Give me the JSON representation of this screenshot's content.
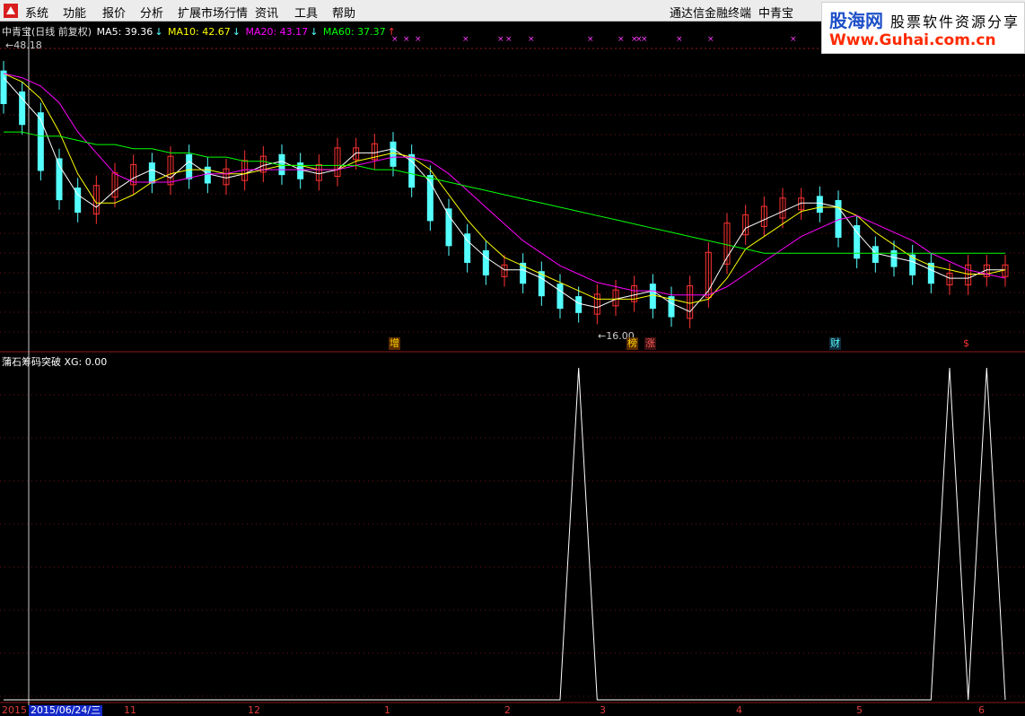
{
  "menu": {
    "items": [
      "系统",
      "功能",
      "报价",
      "分析",
      "扩展市场行情",
      "资讯",
      "工具",
      "帮助"
    ],
    "right_title": "通达信金融终端",
    "stock_name": "中青宝"
  },
  "watermark": {
    "brand": "股海网",
    "slogan": "股票软件资源分享",
    "url": "Www.Guhai.com.cn"
  },
  "main_panel": {
    "title": "中青宝(日线 前复权)",
    "ma5": "MA5: 39.36",
    "ma10": "MA10: 42.67",
    "ma20": "MA20: 43.17",
    "ma60": "MA60: 37.37",
    "high_label": "48.18",
    "low_label": "16.00",
    "colors": {
      "ma5": "#ffffff",
      "ma10": "#ffff00",
      "ma20": "#ff00ff",
      "ma60": "#00ff00",
      "up": "#ff3232",
      "down": "#54ffff"
    }
  },
  "events": [
    {
      "text": "增",
      "color": "#ffd700",
      "bg": "#5a2a00"
    },
    {
      "text": "榜",
      "color": "#ffd700",
      "bg": "#5a2a00"
    },
    {
      "text": "涨",
      "color": "#ff5a5a",
      "bg": "#3a1010"
    },
    {
      "text": "财",
      "color": "#54ffff",
      "bg": "#102a3a"
    },
    {
      "text": "$",
      "color": "#ff3232",
      "bg": "#000000"
    }
  ],
  "indicator_panel": {
    "title": "蒲石筹码突破",
    "value": "XG: 0.00"
  },
  "date_axis": {
    "year": "2015",
    "cursor": "2015/06/24/三",
    "labels": [
      "11",
      "12",
      "1",
      "2",
      "3",
      "4",
      "5",
      "6"
    ]
  },
  "chart_data": [
    {
      "type": "line",
      "series": [
        {
          "name": "MA5",
          "values": [
            46.5,
            44,
            41.5,
            36,
            32.5,
            31,
            33,
            34.5,
            35.5,
            34.5,
            36.5,
            35,
            34.5,
            35,
            36,
            36.5,
            35.5,
            35,
            35.5,
            37.5,
            37.5,
            38,
            36.5,
            34,
            30,
            27,
            25,
            23.5,
            23.5,
            22.5,
            21,
            19.5,
            19,
            20,
            20.5,
            21,
            19.5,
            18.5,
            21,
            25,
            28.5,
            29.5,
            30.5,
            31.5,
            31.5,
            31,
            28,
            25.5,
            25,
            24.5,
            23.5,
            22.5,
            22.5,
            23.5,
            23.5
          ]
        },
        {
          "name": "MA10",
          "values": [
            47,
            46,
            44,
            40,
            35,
            31.5,
            31.5,
            32.5,
            34,
            35,
            35.5,
            35.5,
            35,
            35,
            35.5,
            36,
            36,
            35.5,
            35.5,
            36.5,
            37,
            37.5,
            37,
            35.5,
            32.5,
            29.5,
            27,
            25,
            24,
            23,
            22,
            21,
            20,
            20,
            20,
            20.5,
            20,
            19.5,
            20,
            22.5,
            26,
            27.5,
            29,
            30.5,
            31,
            31,
            30,
            28,
            26.5,
            25,
            24,
            23.5,
            23,
            23,
            23.5
          ]
        },
        {
          "name": "MA20",
          "values": [
            47,
            46.5,
            45.5,
            43.5,
            40,
            37.5,
            35,
            34,
            34,
            34,
            34.5,
            35,
            35,
            35.5,
            35.5,
            35.5,
            35.5,
            35.5,
            35.5,
            36,
            36.5,
            37,
            37,
            36.5,
            35,
            33,
            31,
            29,
            27,
            25.5,
            24,
            23,
            22,
            21.5,
            21,
            21,
            20.5,
            20.5,
            20.5,
            21.5,
            23,
            24.5,
            26,
            27.5,
            28.5,
            29.5,
            30,
            29,
            28,
            27,
            25.5,
            24.5,
            23.5,
            23,
            22.5
          ]
        },
        {
          "name": "MA60",
          "values": [
            40,
            40,
            39.5,
            39.5,
            39,
            38.5,
            38.5,
            38,
            38,
            37.5,
            37.5,
            37,
            37,
            36.5,
            36.5,
            36,
            36,
            36,
            36,
            36,
            35.5,
            35.5,
            35,
            34.5,
            34,
            33.5,
            33,
            32.5,
            32,
            31.5,
            31,
            30.5,
            30,
            29.5,
            29,
            28.5,
            28,
            27.5,
            27,
            26.5,
            26,
            25.5,
            25.5,
            25.5,
            25.5,
            25.5,
            25.5,
            25.5,
            25.5,
            25.5,
            25.5,
            25.5,
            25.5,
            25.5,
            25.5
          ]
        }
      ],
      "ylim": [
        15,
        50
      ]
    },
    {
      "type": "line",
      "series": [
        {
          "name": "XG",
          "values": [
            0,
            0,
            0,
            0,
            0,
            0,
            0,
            0,
            0,
            0,
            0,
            0,
            0,
            0,
            0,
            0,
            0,
            0,
            0,
            0,
            0,
            0,
            0,
            0,
            0,
            0,
            0,
            0,
            0,
            0,
            0,
            1,
            0,
            0,
            0,
            0,
            0,
            0,
            0,
            0,
            0,
            0,
            0,
            0,
            0,
            0,
            0,
            0,
            0,
            0,
            0,
            1,
            0,
            1,
            0
          ]
        }
      ],
      "ylim": [
        0,
        1
      ]
    }
  ]
}
